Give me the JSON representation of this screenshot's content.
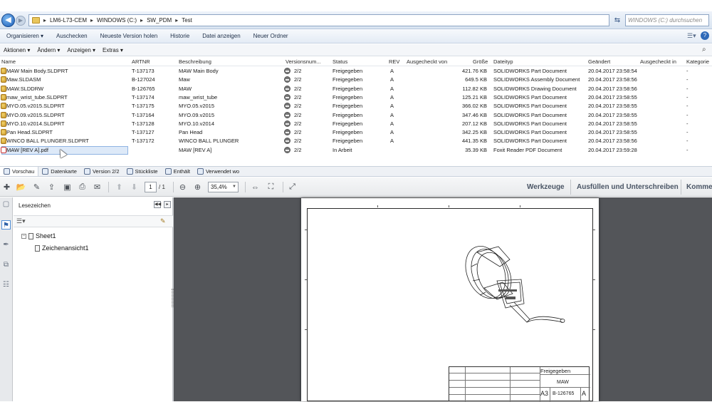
{
  "address_bar": {
    "breadcrumbs": [
      "LM6-L73-CEM",
      "WINDOWS (C:)",
      "SW_PDM",
      "Test"
    ],
    "search_placeholder": "WINDOWS (C:) durchsuchen"
  },
  "command_bar": {
    "items": [
      "Organisieren ▾",
      "Auschecken",
      "Neueste Version holen",
      "Historie",
      "Datei anzeigen",
      "Neuer Ordner"
    ]
  },
  "pdm_toolbar": {
    "items": [
      "Aktionen ▾",
      "Ändern ▾",
      "Anzeigen ▾",
      "Extras ▾"
    ]
  },
  "file_list": {
    "columns": [
      "Name",
      "ARTNR",
      "Beschreibung",
      "Versionsnum...",
      "Status",
      "REV",
      "Ausgecheckt von",
      "Größe",
      "Dateityp",
      "Geändert",
      "Ausgecheckt in",
      "Kategorie"
    ],
    "rows": [
      {
        "name": "MAW Main Body.SLDPRT",
        "artnr": "T-137173",
        "desc": "MAW Main Body",
        "version": "2/2",
        "status": "Freigegeben",
        "rev": "A",
        "size": "421.76 KB",
        "type": "SOLIDWORKS Part Document",
        "modified": "20.04.2017 23:58:54",
        "category": "-"
      },
      {
        "name": "Maw.SLDASM",
        "artnr": "B-127024",
        "desc": "Maw",
        "version": "2/2",
        "status": "Freigegeben",
        "rev": "A",
        "size": "649.5 KB",
        "type": "SOLIDWORKS Assembly Document",
        "modified": "20.04.2017 23:58:56",
        "category": "-"
      },
      {
        "name": "MAW.SLDDRW",
        "artnr": "B-126765",
        "desc": "MAW",
        "version": "2/2",
        "status": "Freigegeben",
        "rev": "A",
        "size": "112.82 KB",
        "type": "SOLIDWORKS Drawing Document",
        "modified": "20.04.2017 23:58:56",
        "category": "-"
      },
      {
        "name": "maw_wrist_tube.SLDPRT",
        "artnr": "T-137174",
        "desc": "maw_wrist_tube",
        "version": "2/2",
        "status": "Freigegeben",
        "rev": "A",
        "size": "125.21 KB",
        "type": "SOLIDWORKS Part Document",
        "modified": "20.04.2017 23:58:55",
        "category": "-"
      },
      {
        "name": "MYO.05.v2015.SLDPRT",
        "artnr": "T-137175",
        "desc": "MYO.05.v2015",
        "version": "2/2",
        "status": "Freigegeben",
        "rev": "A",
        "size": "366.02 KB",
        "type": "SOLIDWORKS Part Document",
        "modified": "20.04.2017 23:58:55",
        "category": "-"
      },
      {
        "name": "MYO.09.v2015.SLDPRT",
        "artnr": "T-137164",
        "desc": "MYO.09.v2015",
        "version": "2/2",
        "status": "Freigegeben",
        "rev": "A",
        "size": "347.46 KB",
        "type": "SOLIDWORKS Part Document",
        "modified": "20.04.2017 23:58:55",
        "category": "-"
      },
      {
        "name": "MYO.10.v2014.SLDPRT",
        "artnr": "T-137128",
        "desc": "MYO.10.v2014",
        "version": "2/2",
        "status": "Freigegeben",
        "rev": "A",
        "size": "207.12 KB",
        "type": "SOLIDWORKS Part Document",
        "modified": "20.04.2017 23:58:55",
        "category": "-"
      },
      {
        "name": "Pan Head.SLDPRT",
        "artnr": "T-137127",
        "desc": "Pan Head",
        "version": "2/2",
        "status": "Freigegeben",
        "rev": "A",
        "size": "342.25 KB",
        "type": "SOLIDWORKS Part Document",
        "modified": "20.04.2017 23:58:55",
        "category": "-"
      },
      {
        "name": "WINCO BALL PLUNGER.SLDPRT",
        "artnr": "T-137172",
        "desc": "WINCO BALL PLUNGER",
        "version": "2/2",
        "status": "Freigegeben",
        "rev": "A",
        "size": "441.35 KB",
        "type": "SOLIDWORKS Part Document",
        "modified": "20.04.2017 23:58:56",
        "category": "-"
      },
      {
        "name": "MAW [REV A].pdf",
        "artnr": "",
        "desc": "MAW [REV A]",
        "version": "2/2",
        "status": "In Arbeit",
        "rev": "",
        "size": "35.39 KB",
        "type": "Foxit Reader PDF Document",
        "modified": "20.04.2017 23:59:28",
        "category": "-"
      }
    ]
  },
  "tabs": [
    "Vorschau",
    "Datenkarte",
    "Version 2/2",
    "Stückliste",
    "Enthält",
    "Verwendet wo"
  ],
  "pdf_toolbar": {
    "page_current": "1",
    "page_total": "/ 1",
    "zoom": "35,4%",
    "panel_tools": "Werkzeuge",
    "panel_fill": "Ausfüllen und Unterschreiben",
    "panel_comment": "Kommentar"
  },
  "bookmarks": {
    "title": "Lesezeichen",
    "items": [
      "Sheet1",
      "Zeichenansicht1"
    ]
  },
  "title_block": {
    "status": "Freigegeben",
    "name": "MAW",
    "size": "A3",
    "number": "B-126765",
    "rev": "A"
  },
  "colors": {
    "selection": "#dde9f8",
    "doc_background": "#535559",
    "link_blue": "#2e69b8"
  }
}
